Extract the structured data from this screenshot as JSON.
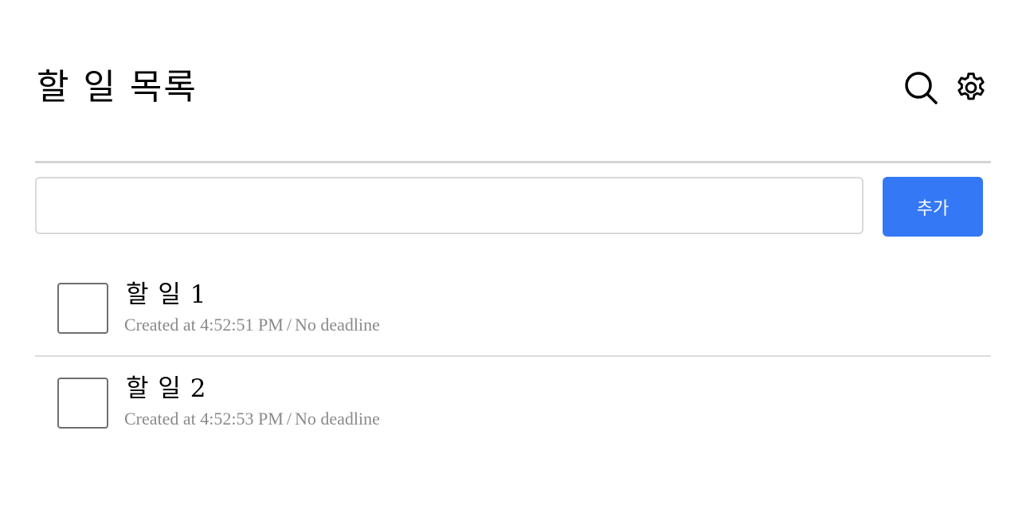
{
  "header": {
    "title": "할 일 목록",
    "search_icon": "search-icon",
    "settings_icon": "gear-icon"
  },
  "add_form": {
    "input_value": "",
    "input_placeholder": "",
    "add_label": "추가"
  },
  "tasks": [
    {
      "title": "할 일 1",
      "created": "Created at 4:52:51 PM",
      "separator": "/",
      "deadline": "No deadline",
      "checked": false
    },
    {
      "title": "할 일 2",
      "created": "Created at 4:52:53 PM",
      "separator": "/",
      "deadline": "No deadline",
      "checked": false
    }
  ],
  "colors": {
    "accent": "#3478f6",
    "divider": "#d4d4d4",
    "meta_text": "#8a8a8a"
  }
}
